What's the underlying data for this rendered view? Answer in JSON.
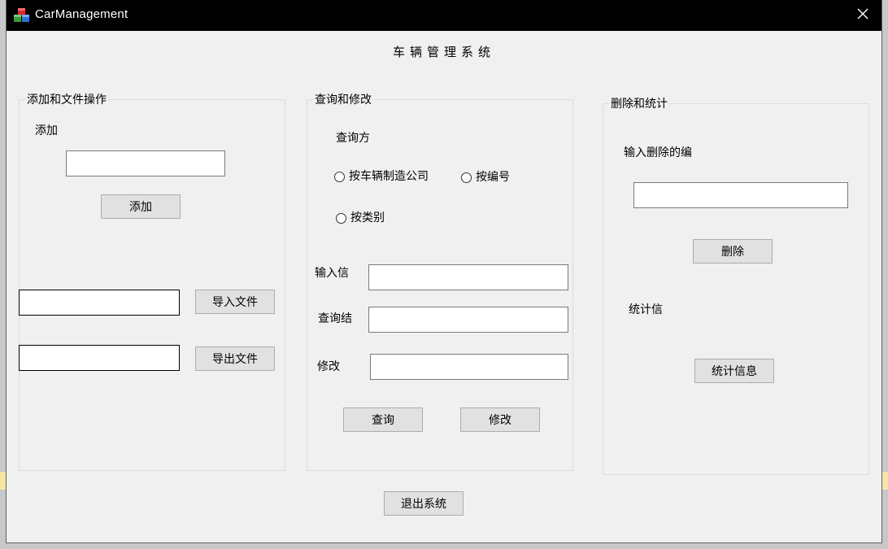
{
  "window": {
    "title": "CarManagement",
    "icon": "app-cubes-icon",
    "close_icon": "close-icon"
  },
  "header": {
    "title": "车辆管理系统"
  },
  "add_group": {
    "legend": "添加和文件操作",
    "add_label": "添加",
    "add_input_value": "",
    "add_button": "添加",
    "import_input_value": "",
    "import_button": "导入文件",
    "export_input_value": "",
    "export_button": "导出文件"
  },
  "query_group": {
    "legend": "查询和修改",
    "method_label": "查询方",
    "radio_maker": "按车辆制造公司",
    "radio_number": "按编号",
    "radio_category": "按类别",
    "input_label": "输入信",
    "input_value": "",
    "result_label": "查询结",
    "result_value": "",
    "modify_label": "修改",
    "modify_value": "",
    "query_button": "查询",
    "modify_button": "修改"
  },
  "delete_group": {
    "legend": "删除和统计",
    "delete_prompt": "输入删除的编",
    "delete_input_value": "",
    "delete_button": "删除",
    "stats_label": "统计信",
    "stats_button": "统计信息"
  },
  "footer": {
    "exit_button": "退出系统"
  },
  "colors": {
    "titlebar": "#000000",
    "window_bg": "#f0f0f0",
    "button_bg": "#e1e1e1"
  }
}
